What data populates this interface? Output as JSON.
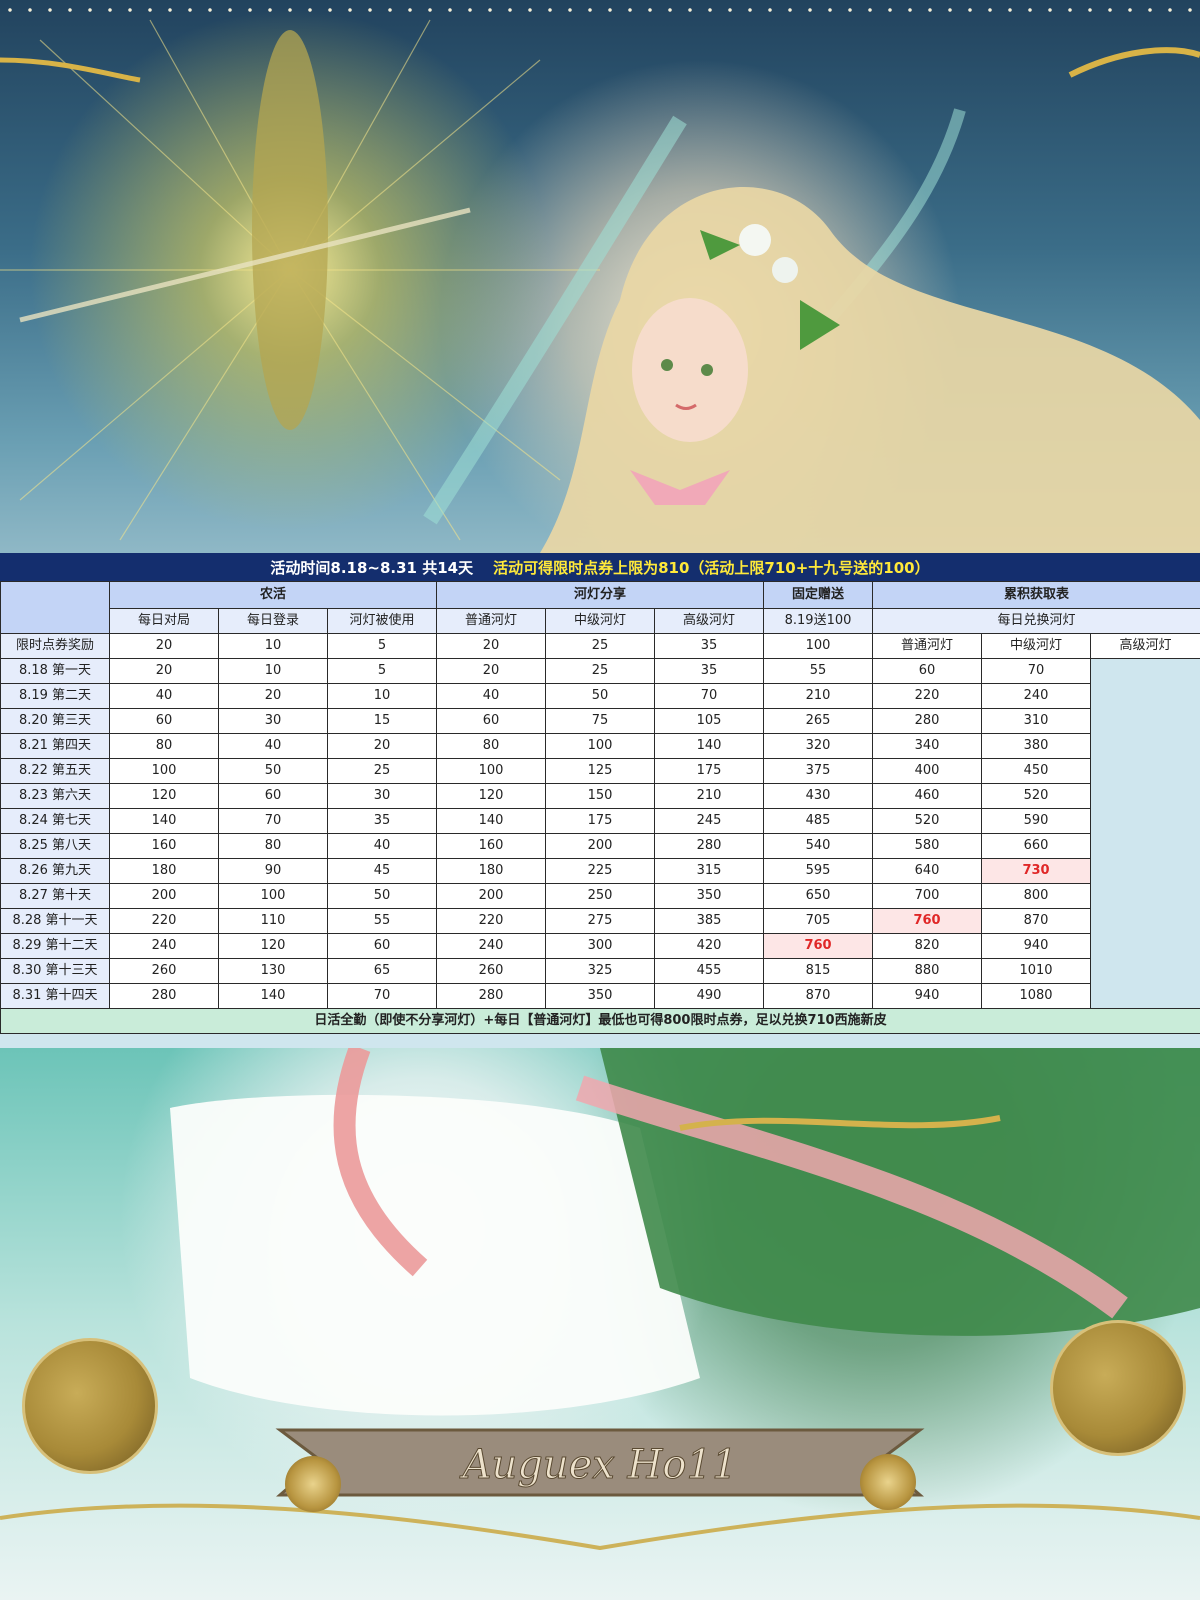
{
  "banner": {
    "period": "活动时间8.18~8.31 共14天",
    "cap": "活动可得限时点券上限为810（活动上限710+十九号送的100）"
  },
  "groups": {
    "farm": "农活",
    "lantern_share": "河灯分享",
    "fixed_gift": "固定赠送",
    "cumulative": "累积获取表"
  },
  "subheaders": {
    "daily_match": "每日对局",
    "daily_login": "每日登录",
    "lantern_used": "河灯被使用",
    "normal_lantern": "普通河灯",
    "mid_lantern": "中级河灯",
    "high_lantern": "高级河灯",
    "gift_819": "8.19送100",
    "daily_exchange": "每日兑换河灯"
  },
  "reward_row": {
    "label": "限时点券奖励",
    "values": [
      "20",
      "10",
      "5",
      "20",
      "25",
      "35"
    ],
    "cum_headers": [
      "普通河灯",
      "中级河灯",
      "高级河灯"
    ]
  },
  "fixed_gift_value": "100",
  "rows": [
    {
      "label": "8.18 第一天",
      "values": [
        "20",
        "10",
        "5",
        "20",
        "25",
        "35"
      ],
      "cum": [
        "55",
        "60",
        "70"
      ]
    },
    {
      "label": "8.19 第二天",
      "values": [
        "40",
        "20",
        "10",
        "40",
        "50",
        "70"
      ],
      "cum": [
        "210",
        "220",
        "240"
      ]
    },
    {
      "label": "8.20 第三天",
      "values": [
        "60",
        "30",
        "15",
        "60",
        "75",
        "105"
      ],
      "cum": [
        "265",
        "280",
        "310"
      ]
    },
    {
      "label": "8.21 第四天",
      "values": [
        "80",
        "40",
        "20",
        "80",
        "100",
        "140"
      ],
      "cum": [
        "320",
        "340",
        "380"
      ]
    },
    {
      "label": "8.22 第五天",
      "values": [
        "100",
        "50",
        "25",
        "100",
        "125",
        "175"
      ],
      "cum": [
        "375",
        "400",
        "450"
      ]
    },
    {
      "label": "8.23 第六天",
      "values": [
        "120",
        "60",
        "30",
        "120",
        "150",
        "210"
      ],
      "cum": [
        "430",
        "460",
        "520"
      ]
    },
    {
      "label": "8.24 第七天",
      "values": [
        "140",
        "70",
        "35",
        "140",
        "175",
        "245"
      ],
      "cum": [
        "485",
        "520",
        "590"
      ]
    },
    {
      "label": "8.25 第八天",
      "values": [
        "160",
        "80",
        "40",
        "160",
        "200",
        "280"
      ],
      "cum": [
        "540",
        "580",
        "660"
      ]
    },
    {
      "label": "8.26 第九天",
      "values": [
        "180",
        "90",
        "45",
        "180",
        "225",
        "315"
      ],
      "cum": [
        "595",
        "640",
        "730"
      ]
    },
    {
      "label": "8.27 第十天",
      "values": [
        "200",
        "100",
        "50",
        "200",
        "250",
        "350"
      ],
      "cum": [
        "650",
        "700",
        "800"
      ]
    },
    {
      "label": "8.28 第十一天",
      "values": [
        "220",
        "110",
        "55",
        "220",
        "275",
        "385"
      ],
      "cum": [
        "705",
        "760",
        "870"
      ]
    },
    {
      "label": "8.29 第十二天",
      "values": [
        "240",
        "120",
        "60",
        "240",
        "300",
        "420"
      ],
      "cum": [
        "760",
        "820",
        "940"
      ]
    },
    {
      "label": "8.30 第十三天",
      "values": [
        "260",
        "130",
        "65",
        "260",
        "325",
        "455"
      ],
      "cum": [
        "815",
        "880",
        "1010"
      ]
    },
    {
      "label": "8.31 第十四天",
      "values": [
        "280",
        "140",
        "70",
        "280",
        "350",
        "490"
      ],
      "cum": [
        "870",
        "940",
        "1080"
      ]
    }
  ],
  "highlights": [
    {
      "row": 8,
      "col": 2
    },
    {
      "row": 10,
      "col": 1
    },
    {
      "row": 11,
      "col": 0
    }
  ],
  "footer": "日活全勤（即使不分享河灯）+每日【普通河灯】最低也可得800限时点券，足以兑换710西施新皮",
  "logo_text": "Auguex Ho11",
  "colors": {
    "banner_bg": "#142e6e",
    "banner_highlight": "#ffe93a",
    "header_bg": "#c3d4f6",
    "subheader_bg": "#e6edfb",
    "footer_bg": "#c9ecd9",
    "highlight_bg": "#fde6e6",
    "highlight_text": "#e02828"
  }
}
